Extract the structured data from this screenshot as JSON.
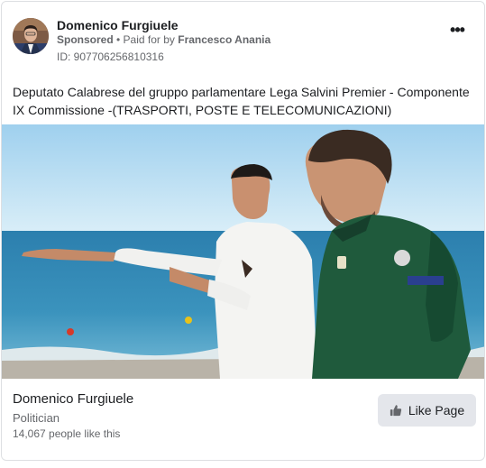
{
  "post": {
    "page_name": "Domenico Furgiuele",
    "sponsored_label": "Sponsored",
    "separator": " • ",
    "paid_for_prefix": "Paid for by ",
    "payer": "Francesco Anania",
    "ad_id": "ID: 907706256810316",
    "more_icon": "•••",
    "caption": "Deputato Calabrese del gruppo parlamentare Lega Salvini Premier - Componente IX Commissione -(TRASPORTI, POSTE E TELECOMUNICAZIONI)"
  },
  "footer": {
    "page_name": "Domenico Furgiuele",
    "category": "Politician",
    "likes": "14,067 people like this",
    "like_button_label": "Like Page"
  },
  "icons": {
    "more": "ellipsis-icon",
    "like": "thumbs-up-icon"
  },
  "colors": {
    "secondary_text": "#65676b",
    "button_bg": "#e4e6eb",
    "border": "#dddfe2"
  }
}
